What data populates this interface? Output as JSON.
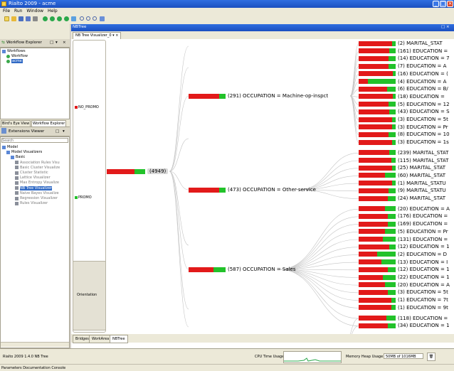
{
  "window": {
    "title": "Rialto 2009 - acme"
  },
  "menu": [
    "File",
    "Run",
    "Window",
    "Help"
  ],
  "toolbar_icons": [
    "new-icon",
    "open-icon",
    "save-icon",
    "save-as-icon",
    "print-icon",
    "run-icon",
    "stop-icon",
    "step-icon",
    "record-icon",
    "zoom-in-icon",
    "zoom-out-icon",
    "zoom-fit-icon",
    "refresh-icon"
  ],
  "workflow_explorer": {
    "tab_label": "Workflow Explorer",
    "tree": [
      "Workflows",
      "Workflow",
      "acme"
    ]
  },
  "view_tabs": [
    "Bird's Eye View",
    "Workflow Explorer"
  ],
  "extensions_viewer": {
    "title": "Extensions Viewer",
    "search_placeholder": "Search",
    "tree": [
      {
        "label": "Model",
        "level": 0
      },
      {
        "label": "Model Visualizers",
        "level": 1
      },
      {
        "label": "Basic",
        "level": 2
      },
      {
        "label": "Association Rules Visu",
        "level": 3
      },
      {
        "label": "Basic Cluster Visualize",
        "level": 3
      },
      {
        "label": "Cluster Statistic",
        "level": 3
      },
      {
        "label": "Lattice Visualizer",
        "level": 3
      },
      {
        "label": "Max Entropy Visualize",
        "level": 3
      },
      {
        "label": "NB Tree Visualizer",
        "level": 3,
        "selected": true
      },
      {
        "label": "Naive Bayes Visualize",
        "level": 3
      },
      {
        "label": "Regression Visualizer",
        "level": 3
      },
      {
        "label": "Rules Visualizer",
        "level": 3
      }
    ]
  },
  "editor": {
    "top_tab": "NBTree",
    "sub_tab": "NB Tree Visualizer_0",
    "bottom_tabs": [
      "Bridges",
      "WorkArea",
      "NBTree"
    ]
  },
  "legend": {
    "items": [
      {
        "label": "NO_PROMO",
        "color": "#e21a1a"
      },
      {
        "label": "PROMO",
        "color": "#22c22a"
      }
    ],
    "orientation_label": "Orientation"
  },
  "tree": {
    "root": {
      "label": "(4949)",
      "red": 0.72
    },
    "level1": [
      {
        "label": "(291) OCCUPATION = Machine-op-inspct",
        "red": 0.82
      },
      {
        "label": "(473) OCCUPATION = Other-service",
        "red": 0.83
      },
      {
        "label": "(587) OCCUPATION = Sales",
        "red": 0.68
      }
    ],
    "leaves": [
      {
        "label": "(2) MARITAL_STAT",
        "red": 0.9
      },
      {
        "label": "(161) EDUCATION =",
        "red": 0.82
      },
      {
        "label": "(14) EDUCATION = 7",
        "red": 0.8
      },
      {
        "label": "(7) EDUCATION = A",
        "red": 0.8
      },
      {
        "label": "(16) EDUCATION = (",
        "red": 0.92
      },
      {
        "label": "(4) EDUCATION = A",
        "red": 0.25
      },
      {
        "label": "(6) EDUCATION = B/",
        "red": 0.76
      },
      {
        "label": "(18) EDUCATION =",
        "red": 0.92
      },
      {
        "label": "(5) EDUCATION = 12",
        "red": 0.8
      },
      {
        "label": "(43) EDUCATION = S",
        "red": 0.83
      },
      {
        "label": "(3) EDUCATION = 5t",
        "red": 0.9
      },
      {
        "label": "(3) EDUCATION = Pr",
        "red": 0.9
      },
      {
        "label": "(8) EDUCATION = 10",
        "red": 0.8
      },
      {
        "label": "(3) EDUCATION = 1s",
        "red": 0.9
      },
      {
        "label": "(239) MARITAL_STAT",
        "red": 0.83
      },
      {
        "label": "(115) MARITAL_STAT",
        "red": 0.88
      },
      {
        "label": "(25) MARITAL_STAT",
        "red": 0.9
      },
      {
        "label": "(60) MARITAL_STAT",
        "red": 0.72
      },
      {
        "label": "(1) MARITAL_STATU",
        "red": 0.9
      },
      {
        "label": "(9) MARITAL_STATU",
        "red": 0.8
      },
      {
        "label": "(24) MARITAL_STAT",
        "red": 0.78
      },
      {
        "label": "(20) EDUCATION = A",
        "red": 0.72
      },
      {
        "label": "(176) EDUCATION =",
        "red": 0.78
      },
      {
        "label": "(169) EDUCATION =",
        "red": 0.78
      },
      {
        "label": "(5) EDUCATION = Pr",
        "red": 0.72
      },
      {
        "label": "(131) EDUCATION =",
        "red": 0.65
      },
      {
        "label": "(12) EDUCATION = 1",
        "red": 0.82
      },
      {
        "label": "(2) EDUCATION = D",
        "red": 0.5
      },
      {
        "label": "(13) EDUCATION = I",
        "red": 0.62
      },
      {
        "label": "(12) EDUCATION = 1",
        "red": 0.78
      },
      {
        "label": "(22) EDUCATION = 1",
        "red": 0.65
      },
      {
        "label": "(20) EDUCATION = A",
        "red": 0.72
      },
      {
        "label": "(3) EDUCATION = 5t",
        "red": 0.78
      },
      {
        "label": "(1) EDUCATION = 7t",
        "red": 0.88
      },
      {
        "label": "(1) EDUCATION = 9t",
        "red": 0.88
      },
      {
        "label": "(118) EDUCATION =",
        "red": 0.75
      },
      {
        "label": "(34) EDUCATION = 1",
        "red": 0.78
      }
    ]
  },
  "status": {
    "app_version": "Rialto 2009 1.4.0  NB Tree",
    "cpu_label": "CPU Time Usage",
    "memory_label": "Memory Heap Usage",
    "memory_value": "50MB of 1016MB"
  },
  "params_tabs": "Parameters  Documentation  Console"
}
